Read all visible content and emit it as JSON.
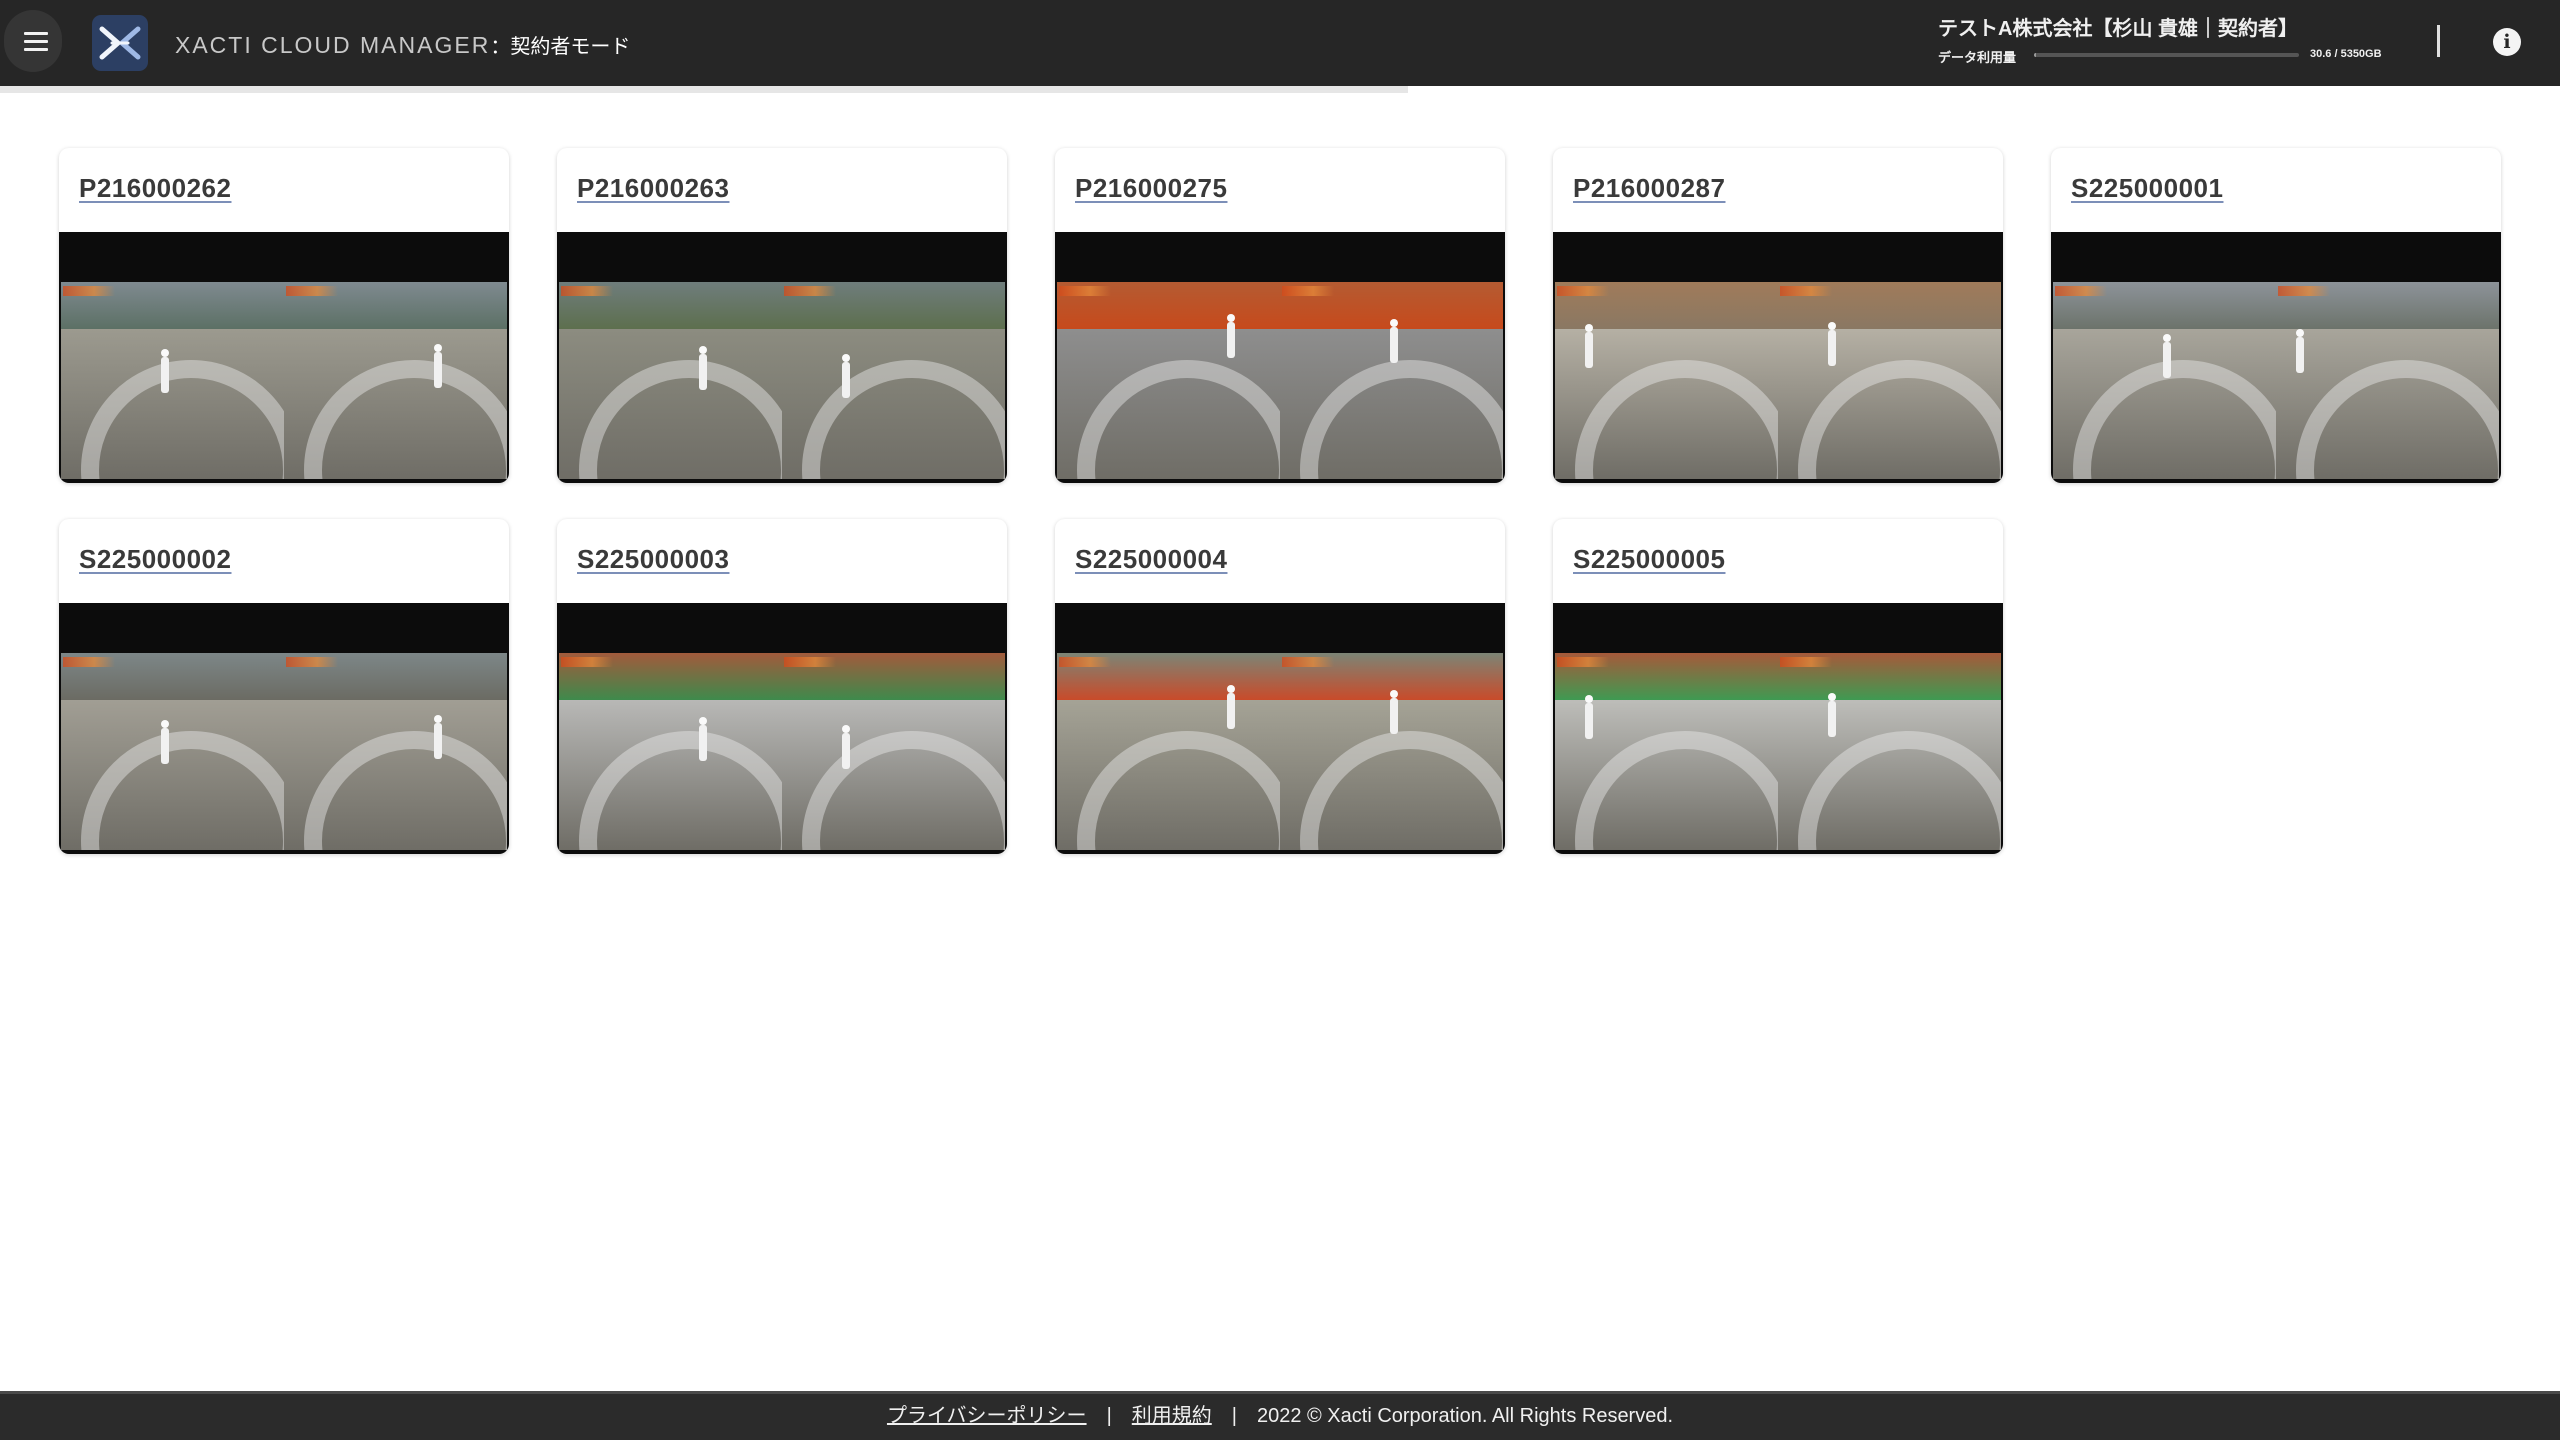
{
  "header": {
    "menu_icon": "hamburger-menu-icon",
    "logo_icon": "xacti-x-logo-icon",
    "app_title": "XACTI CLOUD MANAGER",
    "mode_label": "：契約者モード",
    "user_label": "テストA株式会社【杉山 貴雄｜契約者】",
    "usage_label": "データ利用量",
    "usage_value": "30.6 / 5350GB",
    "usage_fraction": 0.006,
    "info_icon": "info-icon"
  },
  "page_progress_fraction": 0.55,
  "cameras": [
    {
      "id": "P216000262",
      "sky": "#7f8a90",
      "ground": "#9c9a8f",
      "accent": "#5c7065"
    },
    {
      "id": "P216000263",
      "sky": "#6f7d7c",
      "ground": "#8c8c80",
      "accent": "#5d6f4e"
    },
    {
      "id": "P216000275",
      "sky": "#b45b32",
      "ground": "#8e8e8e",
      "accent": "#c74a1c"
    },
    {
      "id": "P216000287",
      "sky": "#a07b5a",
      "ground": "#b5b0a4",
      "accent": "#8a7863"
    },
    {
      "id": "S225000001",
      "sky": "#8d9399",
      "ground": "#a8a59b",
      "accent": "#6c736b"
    },
    {
      "id": "S225000002",
      "sky": "#7d8788",
      "ground": "#a19e94",
      "accent": "#6b6b63"
    },
    {
      "id": "S225000003",
      "sky": "#a25a3c",
      "ground": "#b8b8b6",
      "accent": "#3e8a4c"
    },
    {
      "id": "S225000004",
      "sky": "#7c8576",
      "ground": "#a5a396",
      "accent": "#c94b2a"
    },
    {
      "id": "S225000005",
      "sky": "#a6593a",
      "ground": "#bdbdb9",
      "accent": "#3f9a52"
    }
  ],
  "footer": {
    "privacy_link": "プライバシーポリシー",
    "terms_link": "利用規約",
    "separator": "|",
    "copyright": "2022 © Xacti Corporation. All Rights Reserved."
  }
}
